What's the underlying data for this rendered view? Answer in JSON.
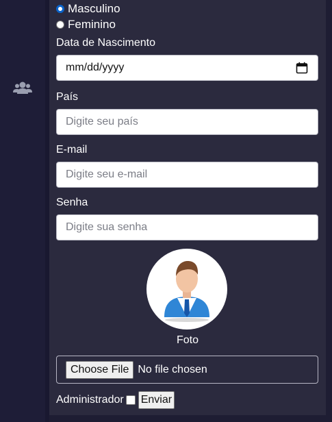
{
  "sidebar": {
    "icon": "users-icon"
  },
  "form": {
    "gender_options": [
      {
        "label": "Masculino",
        "checked": true
      },
      {
        "label": "Feminino",
        "checked": false
      }
    ],
    "birthdate": {
      "label": "Data de Nascimento",
      "value": "mm/dd/yyyy"
    },
    "country": {
      "label": "País",
      "placeholder": "Digite seu país"
    },
    "email": {
      "label": "E-mail",
      "placeholder": "Digite seu e-mail"
    },
    "password": {
      "label": "Senha",
      "placeholder": "Digite sua senha"
    },
    "photo": {
      "label": "Foto",
      "button": "Choose File",
      "status": "No file chosen"
    },
    "admin": {
      "label": "Administrador"
    },
    "submit": "Enviar"
  },
  "colors": {
    "background": "#1f1e36",
    "card": "#2b2a3e",
    "radio_accent": "#0a63c9"
  }
}
